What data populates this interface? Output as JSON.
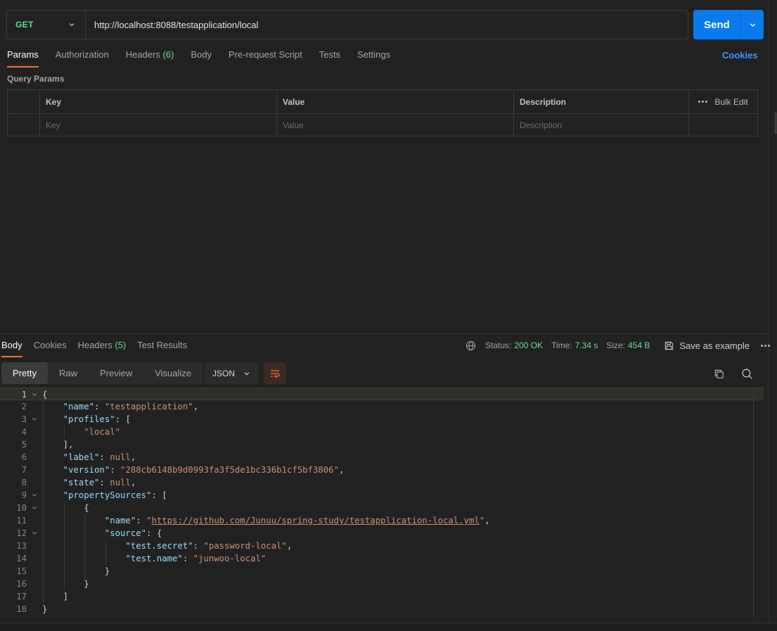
{
  "request": {
    "method": "GET",
    "url": "http://localhost:8088/testapplication/local",
    "send_label": "Send"
  },
  "request_tabs": [
    {
      "label": "Params",
      "active": true
    },
    {
      "label": "Authorization"
    },
    {
      "label": "Headers",
      "count": "(6)"
    },
    {
      "label": "Body"
    },
    {
      "label": "Pre-request Script"
    },
    {
      "label": "Tests"
    },
    {
      "label": "Settings"
    }
  ],
  "cookies_link": "Cookies",
  "query_params": {
    "title": "Query Params",
    "headers": {
      "key": "Key",
      "value": "Value",
      "description": "Description",
      "bulk_edit": "Bulk Edit"
    },
    "placeholders": {
      "key": "Key",
      "value": "Value",
      "description": "Description"
    }
  },
  "response_tabs": [
    {
      "label": "Body",
      "active": true
    },
    {
      "label": "Cookies"
    },
    {
      "label": "Headers",
      "count": "(5)"
    },
    {
      "label": "Test Results"
    }
  ],
  "response_meta": {
    "status_label": "Status:",
    "status_value": "200 OK",
    "time_label": "Time:",
    "time_value": "7.34 s",
    "size_label": "Size:",
    "size_value": "454 B",
    "save_label": "Save as example"
  },
  "viewer": {
    "modes": [
      "Pretty",
      "Raw",
      "Preview",
      "Visualize"
    ],
    "active_mode": "Pretty",
    "format": "JSON"
  },
  "icons": {
    "method_dropdown": "chevron-down-icon",
    "send_dropdown": "chevron-down-icon",
    "globe": "globe-icon",
    "save": "save-icon",
    "wrap": "wrap-lines-icon",
    "copy": "copy-icon",
    "search": "search-icon",
    "more": "more-horizontal-icon"
  },
  "colors": {
    "accent": "#ff6c37",
    "primary": "#097bed",
    "success": "#6bdd9a",
    "link": "#3a9bfd"
  },
  "code_lines": [
    {
      "n": "1",
      "indent": 0,
      "fold": true,
      "current": true,
      "tokens": [
        {
          "t": "{",
          "c": "p"
        }
      ]
    },
    {
      "n": "2",
      "indent": 1,
      "tokens": [
        {
          "t": "\"name\"",
          "c": "k"
        },
        {
          "t": ": ",
          "c": "p"
        },
        {
          "t": "\"testapplication\"",
          "c": "s"
        },
        {
          "t": ",",
          "c": "p"
        }
      ]
    },
    {
      "n": "3",
      "indent": 1,
      "fold": true,
      "tokens": [
        {
          "t": "\"profiles\"",
          "c": "k"
        },
        {
          "t": ": [",
          "c": "p"
        }
      ]
    },
    {
      "n": "4",
      "indent": 2,
      "tokens": [
        {
          "t": "\"local\"",
          "c": "s"
        }
      ]
    },
    {
      "n": "5",
      "indent": 1,
      "tokens": [
        {
          "t": "],",
          "c": "p"
        }
      ]
    },
    {
      "n": "6",
      "indent": 1,
      "tokens": [
        {
          "t": "\"label\"",
          "c": "k"
        },
        {
          "t": ": ",
          "c": "p"
        },
        {
          "t": "null",
          "c": "n"
        },
        {
          "t": ",",
          "c": "p"
        }
      ]
    },
    {
      "n": "7",
      "indent": 1,
      "tokens": [
        {
          "t": "\"version\"",
          "c": "k"
        },
        {
          "t": ": ",
          "c": "p"
        },
        {
          "t": "\"288cb6148b9d0993fa3f5de1bc336b1cf5bf3806\"",
          "c": "s"
        },
        {
          "t": ",",
          "c": "p"
        }
      ]
    },
    {
      "n": "8",
      "indent": 1,
      "tokens": [
        {
          "t": "\"state\"",
          "c": "k"
        },
        {
          "t": ": ",
          "c": "p"
        },
        {
          "t": "null",
          "c": "n"
        },
        {
          "t": ",",
          "c": "p"
        }
      ]
    },
    {
      "n": "9",
      "indent": 1,
      "fold": true,
      "tokens": [
        {
          "t": "\"propertySources\"",
          "c": "k"
        },
        {
          "t": ": [",
          "c": "p"
        }
      ]
    },
    {
      "n": "10",
      "indent": 2,
      "fold": true,
      "tokens": [
        {
          "t": "{",
          "c": "p"
        }
      ]
    },
    {
      "n": "11",
      "indent": 3,
      "tokens": [
        {
          "t": "\"name\"",
          "c": "k"
        },
        {
          "t": ": ",
          "c": "p"
        },
        {
          "t": "\"",
          "c": "s"
        },
        {
          "t": "https://github.com/Junuu/spring-study/testapplication-local.yml",
          "c": "u"
        },
        {
          "t": "\"",
          "c": "s"
        },
        {
          "t": ",",
          "c": "p"
        }
      ]
    },
    {
      "n": "12",
      "indent": 3,
      "fold": true,
      "tokens": [
        {
          "t": "\"source\"",
          "c": "k"
        },
        {
          "t": ": {",
          "c": "p"
        }
      ]
    },
    {
      "n": "13",
      "indent": 4,
      "tokens": [
        {
          "t": "\"test.secret\"",
          "c": "k"
        },
        {
          "t": ": ",
          "c": "p"
        },
        {
          "t": "\"password-local\"",
          "c": "s"
        },
        {
          "t": ",",
          "c": "p"
        }
      ]
    },
    {
      "n": "14",
      "indent": 4,
      "tokens": [
        {
          "t": "\"test.name\"",
          "c": "k"
        },
        {
          "t": ": ",
          "c": "p"
        },
        {
          "t": "\"junwoo-local\"",
          "c": "s"
        }
      ]
    },
    {
      "n": "15",
      "indent": 3,
      "tokens": [
        {
          "t": "}",
          "c": "p"
        }
      ]
    },
    {
      "n": "16",
      "indent": 2,
      "tokens": [
        {
          "t": "}",
          "c": "p"
        }
      ]
    },
    {
      "n": "17",
      "indent": 1,
      "tokens": [
        {
          "t": "]",
          "c": "p"
        }
      ]
    },
    {
      "n": "18",
      "indent": 0,
      "tokens": [
        {
          "t": "}",
          "c": "p"
        }
      ]
    }
  ]
}
